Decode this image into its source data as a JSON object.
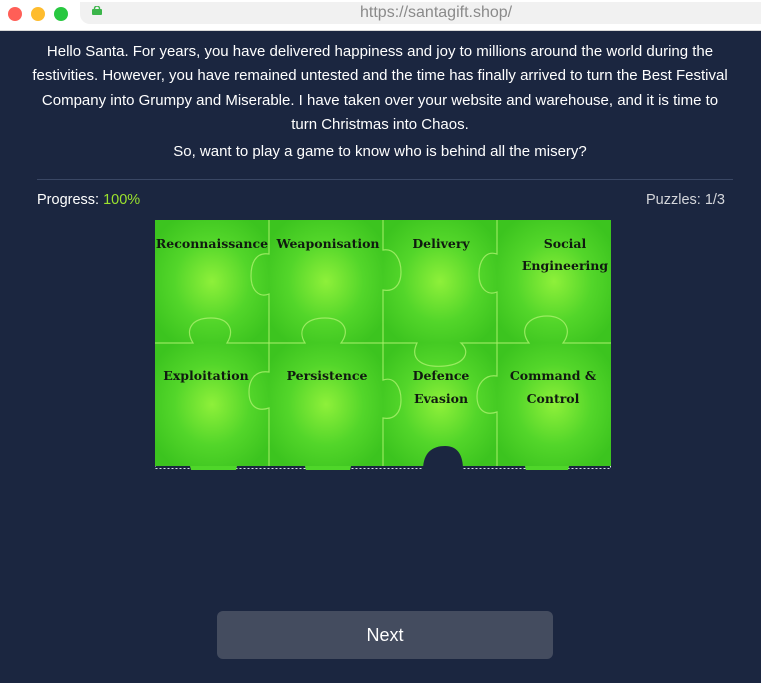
{
  "browser": {
    "url": "https://santagift.shop/"
  },
  "message": {
    "line1": "Hello Santa. For years, you have delivered happiness and joy to millions around the world during the",
    "line2": "festivities. However, you have remained untested and the time has finally arrived to turn the Best Festival",
    "line3": "Company into Grumpy and Miserable. I have taken over your website and warehouse, and it is time to",
    "line4": "turn Christmas into Chaos.",
    "question": "So, want to play a game to know who is behind all the misery?"
  },
  "status": {
    "progress_label": "Progress:",
    "progress_value": "100%",
    "puzzles": "Puzzles: 1/3"
  },
  "puzzle": {
    "color": "#4fd62a",
    "pieces": [
      {
        "line1": "Reconnaissance",
        "line2": ""
      },
      {
        "line1": "Weaponisation",
        "line2": ""
      },
      {
        "line1": "Delivery",
        "line2": ""
      },
      {
        "line1": "Social",
        "line2": "Engineering"
      },
      {
        "line1": "Exploitation",
        "line2": ""
      },
      {
        "line1": "Persistence",
        "line2": ""
      },
      {
        "line1": "Defence",
        "line2": "Evasion"
      },
      {
        "line1": "Command &",
        "line2": "Control"
      }
    ]
  },
  "next_button": "Next"
}
